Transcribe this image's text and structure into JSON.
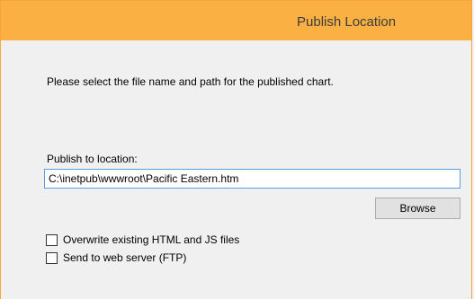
{
  "window": {
    "title": "Publish Location"
  },
  "instruction": "Please select the file name and path for the published chart.",
  "location": {
    "label": "Publish to location:",
    "value": "C:\\inetpub\\wwwroot\\Pacific Eastern.htm"
  },
  "browse_label": "Browse",
  "options": [
    {
      "label": "Overwrite existing HTML and JS files",
      "checked": false
    },
    {
      "label": "Send to web server (FTP)",
      "checked": false
    }
  ],
  "colors": {
    "titlebar": "#fbb043",
    "border": "#f6a73b",
    "focus": "#569de5"
  }
}
